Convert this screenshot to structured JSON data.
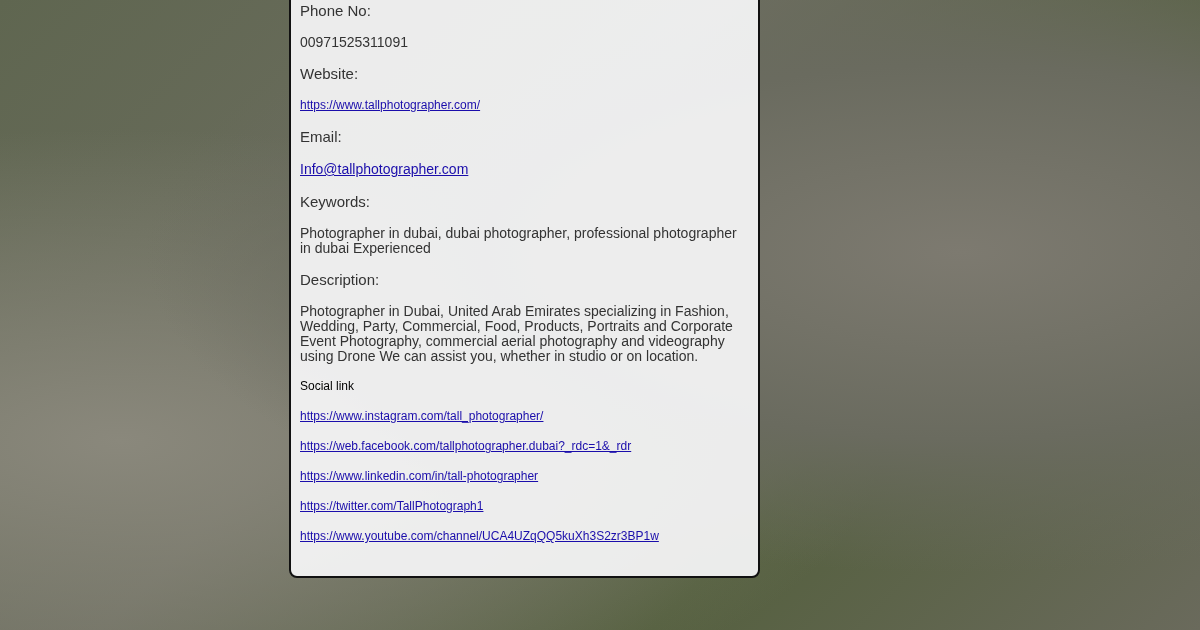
{
  "items": [
    {
      "kind": "heading",
      "text": "Phone No:"
    },
    {
      "kind": "text",
      "text": "00971525311091"
    },
    {
      "kind": "heading",
      "text": "Website:"
    },
    {
      "kind": "link",
      "text": "https://www.tallphotographer.com/"
    },
    {
      "kind": "heading",
      "text": "Email:"
    },
    {
      "kind": "email",
      "text": "Info@tallphotographer.com"
    },
    {
      "kind": "heading",
      "text": "Keywords:"
    },
    {
      "kind": "text",
      "text": "Photographer in dubai, dubai photographer, professional photographer in dubai Experienced"
    },
    {
      "kind": "heading",
      "text": "Description:"
    },
    {
      "kind": "text",
      "text": "Photographer in Dubai, United Arab Emirates specializing in Fashion, Wedding, Party, Commercial, Food, Products, Portraits and Corporate Event Photography, commercial aerial photography and videography using Drone We can assist you, whether in studio or on location."
    },
    {
      "kind": "label",
      "text": "Social link"
    },
    {
      "kind": "link",
      "text": "https://www.instagram.com/tall_photographer/"
    },
    {
      "kind": "link",
      "text": "https://web.facebook.com/tallphotographer.dubai?_rdc=1&_rdr"
    },
    {
      "kind": "link",
      "text": "https://www.linkedin.com/in/tall-photographer"
    },
    {
      "kind": "link",
      "text": "https://twitter.com/TallPhotograph1"
    },
    {
      "kind": "link",
      "text": "https://www.youtube.com/channel/UCA4UZqQQ5kuXh3S2zr3BP1w"
    }
  ]
}
